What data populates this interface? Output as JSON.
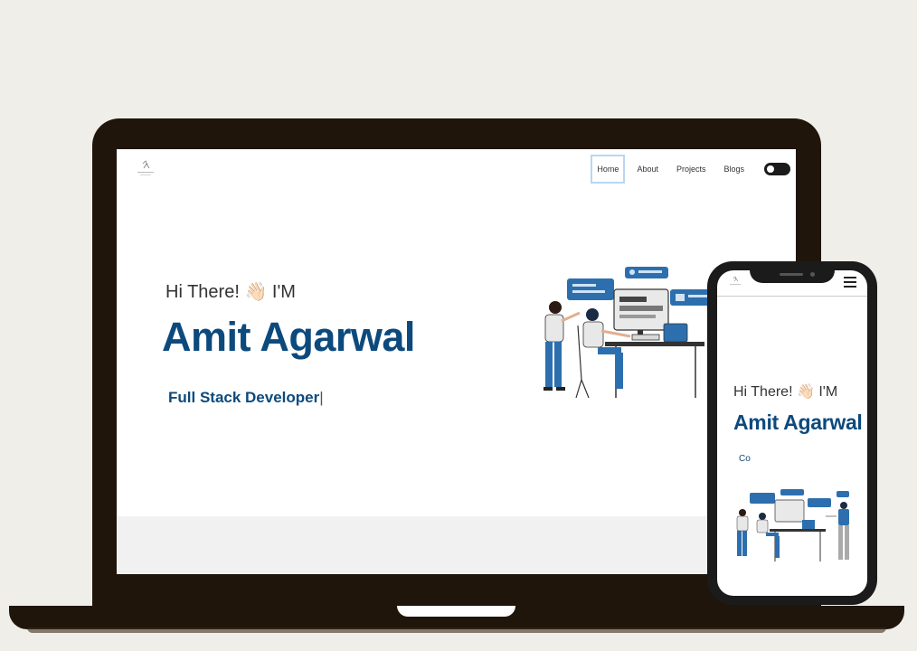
{
  "nav": {
    "items": [
      "Home",
      "About",
      "Projects",
      "Blogs"
    ],
    "active": "Home"
  },
  "hero": {
    "greeting": "Hi There! 👋🏻 I'M",
    "name": "Amit Agarwal",
    "role": "Full Stack Developer",
    "caret": "|"
  },
  "mobile": {
    "greeting": "Hi There! 👋🏻 I'M",
    "name": "Amit Agarwal",
    "role_partial": "Co"
  },
  "colors": {
    "accent": "#0c4a7d",
    "background": "#efeee9",
    "device": "#1f150a"
  },
  "icons": {
    "theme_toggle": "toggle-switch-icon",
    "menu": "hamburger-menu-icon",
    "logo": "site-logo-icon"
  }
}
